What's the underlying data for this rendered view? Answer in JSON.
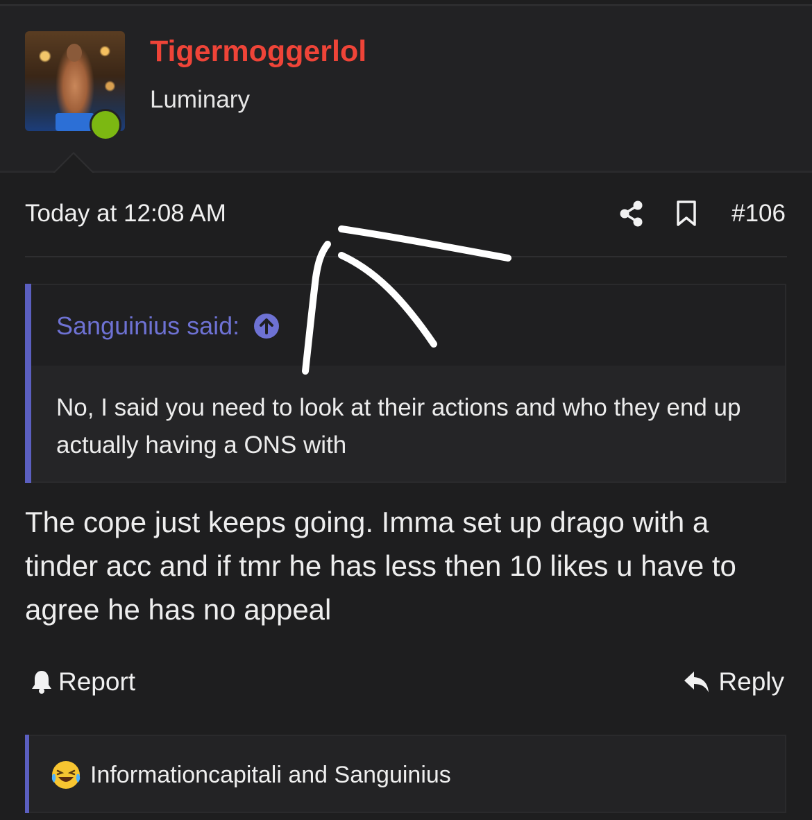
{
  "post": {
    "author": "Tigermoggerlol",
    "user_title": "Luminary",
    "timestamp": "Today at 12:08 AM",
    "post_number": "#106",
    "message": "The cope just keeps going. Imma set up drago with a tinder acc and if tmr he has less then 10 likes u have to agree he has no appeal"
  },
  "quote": {
    "attribution": "Sanguinius said:",
    "text": "No, I said you need to look at their actions and who they end up actually having a ONS with"
  },
  "actions": {
    "report_label": "Report",
    "reply_label": "Reply"
  },
  "reactions": {
    "users": "Informationcapitali and Sanguinius",
    "icon": "laughing-tears-emoji"
  },
  "icons": [
    "share-icon",
    "bookmark-icon",
    "jump-to-quote-icon",
    "bell-icon",
    "reply-icon",
    "laughing-tears-emoji"
  ],
  "colors": {
    "background": "#1e1e1f",
    "username": "#ef4438",
    "quote_accent": "#5b5fc0",
    "online": "#7cb812"
  }
}
